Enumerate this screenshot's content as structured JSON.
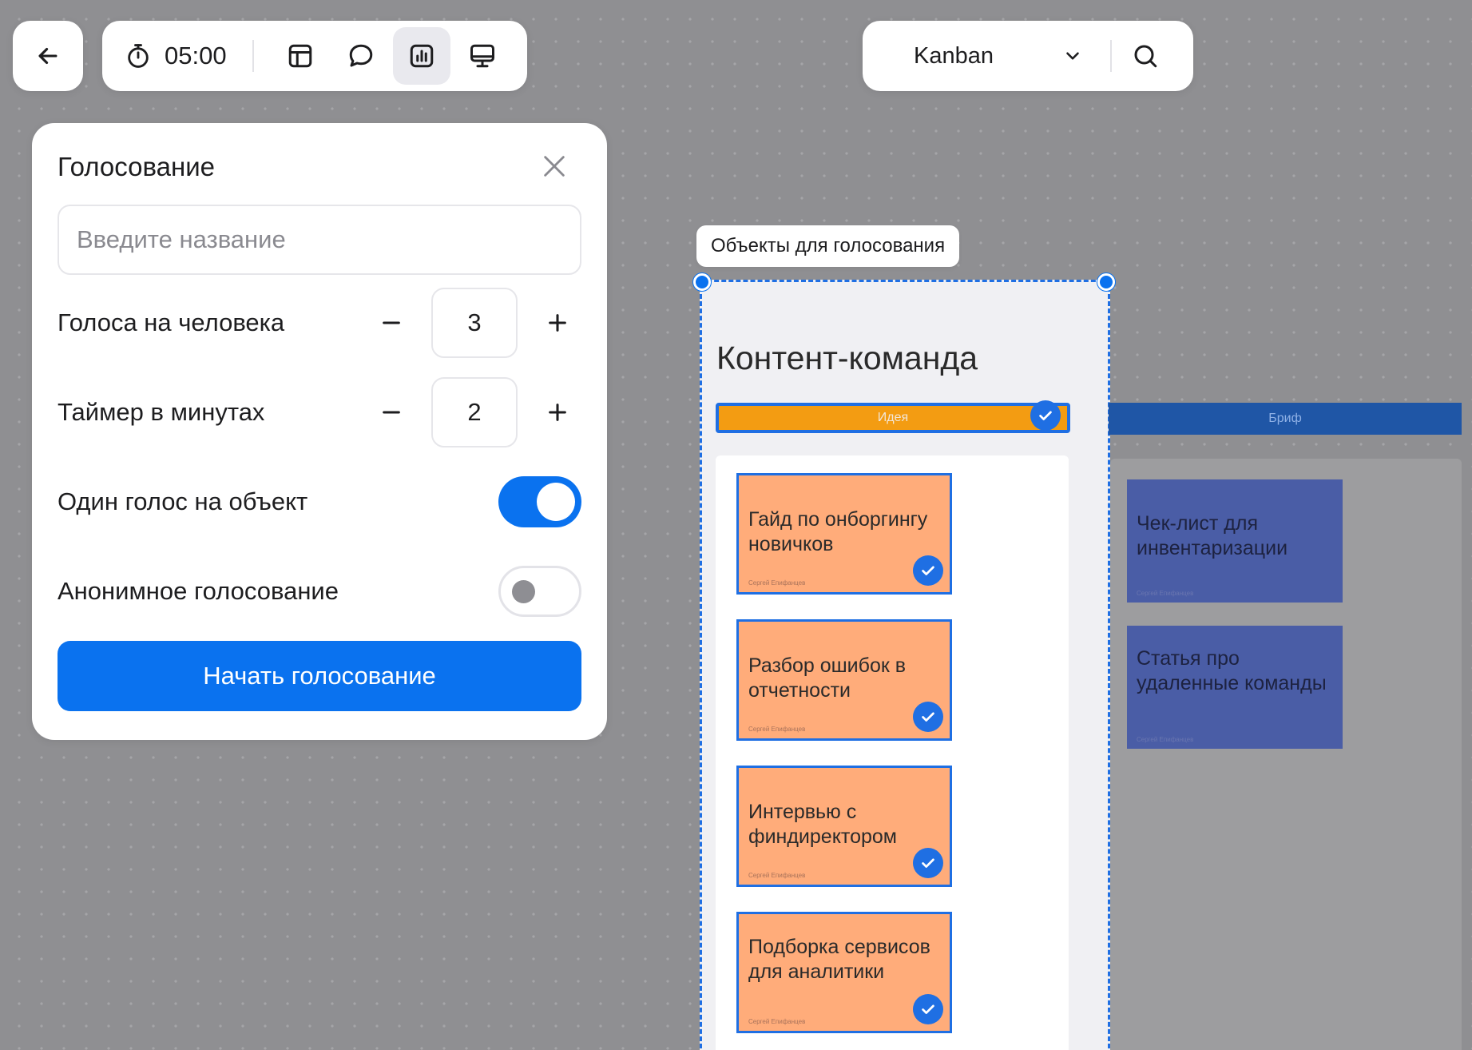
{
  "toolbar": {
    "timer": "05:00",
    "tools": [
      {
        "name": "layout-icon",
        "active": false
      },
      {
        "name": "comment-icon",
        "active": false
      },
      {
        "name": "voting-icon",
        "active": true
      },
      {
        "name": "presentation-icon",
        "active": false
      }
    ]
  },
  "board_selector": {
    "name": "Kanban"
  },
  "voting_panel": {
    "title": "Голосование",
    "name_placeholder": "Введите название",
    "votes_per_person_label": "Голоса на человека",
    "votes_per_person_value": "3",
    "timer_label": "Таймер в минутах",
    "timer_value": "2",
    "one_vote_label": "Один голос на объект",
    "one_vote_enabled": true,
    "anonymous_label": "Анонимное голосование",
    "anonymous_enabled": false,
    "start_label": "Начать голосование"
  },
  "board": {
    "selection_tag": "Объекты для голосования",
    "frame_title": "Контент-команда",
    "columns": [
      {
        "title": "Идея",
        "color": "#f39c12",
        "cards": [
          {
            "text": "Гайд по онборгингу новичков",
            "author": "Сергей Епифанцев"
          },
          {
            "text": "Разбор ошибок в отчетности",
            "author": "Сергей Епифанцев"
          },
          {
            "text": "Интервью с финдиректором",
            "author": "Сергей Епифанцев"
          },
          {
            "text": "Подборка сервисов для аналитики",
            "author": "Сергей Епифанцев"
          }
        ]
      },
      {
        "title": "Бриф",
        "color": "#1f56a6",
        "cards": [
          {
            "text": "Чек-лист для инвентаризации",
            "author": "Сергей Епифанцев"
          },
          {
            "text": "Статья про удаленные команды",
            "author": "Сергей Епифанцев"
          }
        ]
      }
    ]
  },
  "colors": {
    "accent": "#0a72ef",
    "sticky_orange": "#ffac7a",
    "sticky_blue": "#4a5da6"
  }
}
